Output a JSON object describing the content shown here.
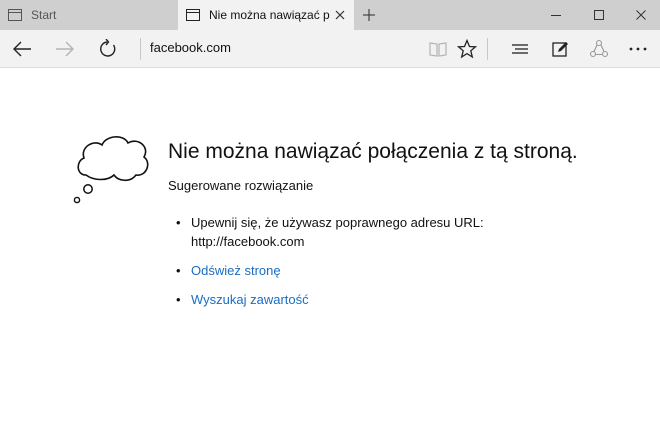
{
  "tabs": [
    {
      "label": "Start",
      "active": false
    },
    {
      "label": "Nie można nawiązać poł",
      "active": true
    }
  ],
  "address": {
    "url": "facebook.com"
  },
  "error": {
    "title": "Nie można nawiązać połączenia z tą stroną.",
    "subtitle": "Sugerowane rozwiązanie",
    "items": [
      {
        "line1": "Upewnij się, że używasz poprawnego adresu URL:",
        "line2": "http://facebook.com"
      },
      {
        "label": "Odśwież stronę"
      },
      {
        "label": "Wyszukaj zawartość"
      }
    ]
  },
  "colors": {
    "link": "#1a6dc4",
    "tabstrip": "#cfcfcf",
    "toolbar": "#f2f2f2"
  },
  "icons": [
    "tab-page-icon",
    "close-icon",
    "new-tab-plus-icon",
    "minimize-icon",
    "maximize-icon",
    "window-close-icon",
    "back-arrow-icon",
    "forward-arrow-icon",
    "refresh-icon",
    "reading-view-icon",
    "favorite-star-icon",
    "hub-icon",
    "web-note-icon",
    "share-icon",
    "more-icon",
    "thought-cloud-icon"
  ]
}
